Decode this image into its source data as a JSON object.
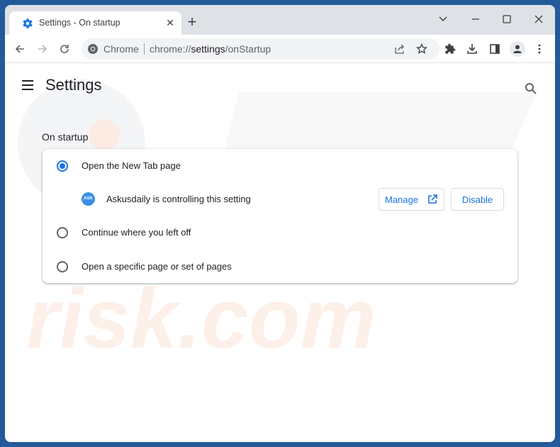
{
  "browser": {
    "tab": {
      "title": "Settings - On startup",
      "icon": "gear-icon",
      "close_icon": "close-icon"
    },
    "new_tab_icon": "plus-icon",
    "window_controls": [
      "chevron-down-icon",
      "minimize-icon",
      "maximize-icon",
      "close-icon"
    ],
    "nav": {
      "back_icon": "arrow-left-icon",
      "forward_icon": "arrow-right-icon",
      "reload_icon": "reload-icon"
    },
    "omnibox": {
      "site_icon": "chrome-icon",
      "site_name": "Chrome",
      "url_prefix": "chrome://",
      "url_host": "settings",
      "url_path": "/onStartup",
      "share_icon": "share-icon",
      "bookmark_icon": "star-icon"
    },
    "toolbar_icons": [
      "puzzle-icon",
      "download-icon",
      "side-panel-icon",
      "profile-icon",
      "more-vert-icon"
    ]
  },
  "settings": {
    "menu_icon": "hamburger-icon",
    "title": "Settings",
    "search_icon": "search-icon",
    "section_title": "On startup",
    "options": [
      {
        "label": "Open the New Tab page",
        "checked": true
      },
      {
        "label": "Continue where you left off",
        "checked": false
      },
      {
        "label": "Open a specific page or set of pages",
        "checked": false
      }
    ],
    "extension": {
      "icon_text": "ASK",
      "text": "Askusdaily is controlling this setting",
      "manage_label": "Manage",
      "disable_label": "Disable"
    }
  },
  "colors": {
    "accent": "#1a73e8",
    "frame": "#235a9a",
    "tabstrip": "#dee1e6"
  }
}
